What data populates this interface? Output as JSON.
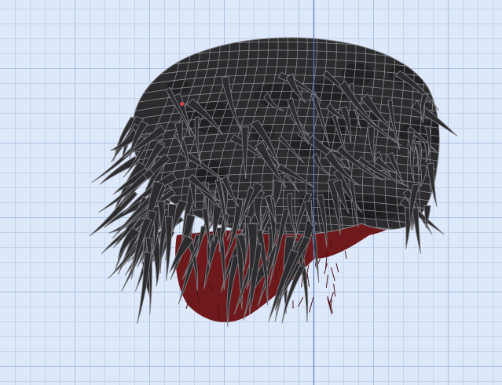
{
  "viewport": {
    "background": "#dde9fb",
    "grid_minor_color": "#c3d3ec",
    "grid_major_color": "#aabfe0",
    "axis_color": "#5c78c4"
  },
  "model": {
    "shell_color": "#2c2c2f",
    "shell_dark_color": "#1a1a1c",
    "wire_color": "#8a8a8e",
    "strand_color": "#7d7d82",
    "inner_color": "#6e1a1d",
    "selected_vertex_color": "#e0404a"
  }
}
